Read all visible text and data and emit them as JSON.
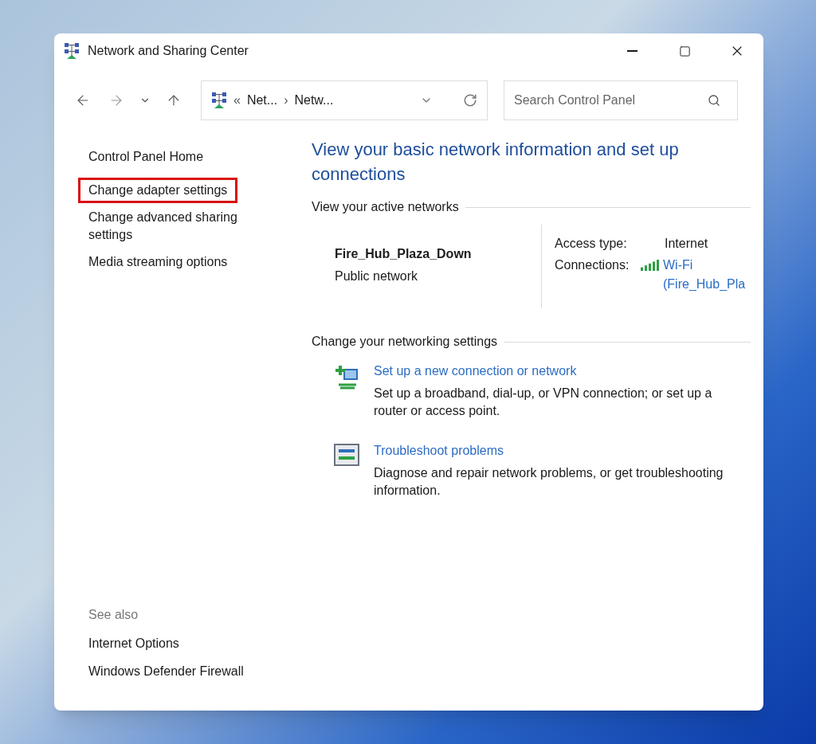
{
  "window": {
    "title": "Network and Sharing Center"
  },
  "address_bar": {
    "overflow": "«",
    "separator": "›",
    "crumbs": [
      "Net...",
      "Netw..."
    ]
  },
  "search": {
    "placeholder": "Search Control Panel"
  },
  "sidebar": {
    "items": [
      {
        "label": "Control Panel Home",
        "highlighted": false
      },
      {
        "label": "Change adapter settings",
        "highlighted": true
      },
      {
        "label": "Change advanced sharing settings",
        "highlighted": false
      },
      {
        "label": "Media streaming options",
        "highlighted": false
      }
    ],
    "see_also_title": "See also",
    "see_also": [
      "Internet Options",
      "Windows Defender Firewall"
    ]
  },
  "main": {
    "heading": "View your basic network information and set up connections",
    "active_networks_title": "View your active networks",
    "network": {
      "name": "Fire_Hub_Plaza_Down",
      "category": "Public network",
      "access_type_label": "Access type:",
      "access_type": "Internet",
      "connections_label": "Connections:",
      "connection": "Wi-Fi (Fire_Hub_Pla"
    },
    "settings_title": "Change your networking settings",
    "tasks": [
      {
        "kind": "new-connection",
        "link": "Set up a new connection or network",
        "description": "Set up a broadband, dial-up, or VPN connection; or set up a router or access point."
      },
      {
        "kind": "troubleshoot",
        "link": "Troubleshoot problems",
        "description": "Diagnose and repair network problems, or get troubleshooting information."
      }
    ]
  }
}
